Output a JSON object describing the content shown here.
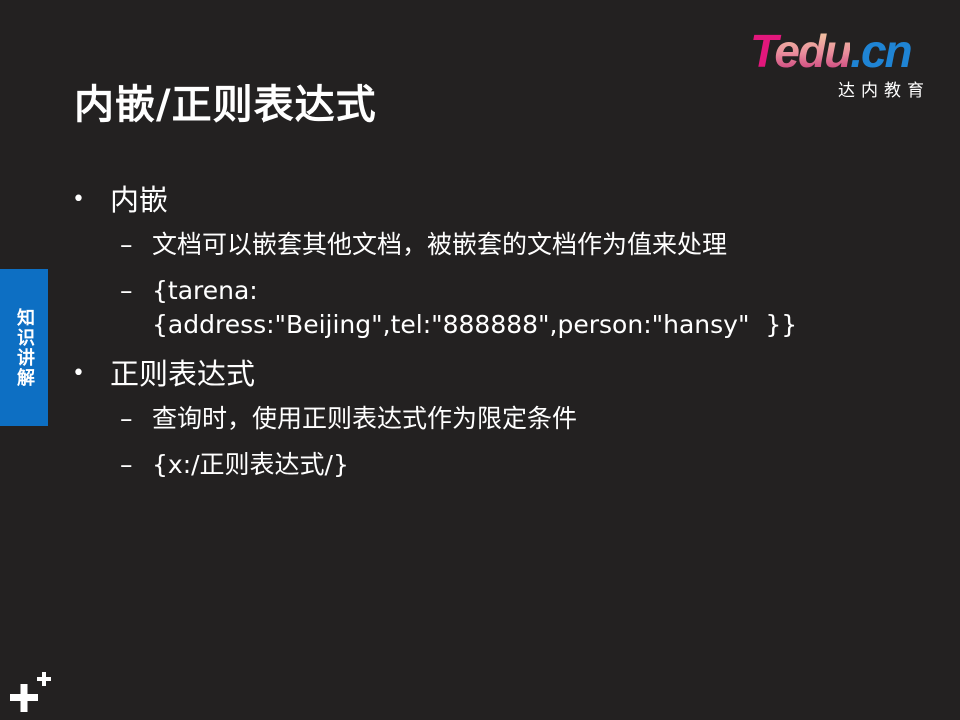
{
  "title": "内嵌/正则表达式",
  "logo": {
    "brand_t": "T",
    "brand_edu": "edu",
    "brand_cn": ".cn",
    "subtitle": "达内教育"
  },
  "side_tab": {
    "label": "知识讲解"
  },
  "bullets": [
    {
      "text": "内嵌",
      "subs": [
        "文档可以嵌套其他文档，被嵌套的文档作为值来处理",
        "{tarena:\n{address:\"Beijing\",tel:\"888888\",person:\"hansy\"  }}"
      ]
    },
    {
      "text": "正则表达式",
      "subs": [
        "查询时，使用正则表达式作为限定条件",
        "{x:/正则表达式/}"
      ]
    }
  ],
  "markers": {
    "bullet": "•",
    "dash": "–"
  },
  "colors": {
    "background": "#232121",
    "text": "#ffffff",
    "side_tab": "#0d6fc3",
    "logo_pink": "#e2177c",
    "logo_blue": "#1f84d4"
  }
}
